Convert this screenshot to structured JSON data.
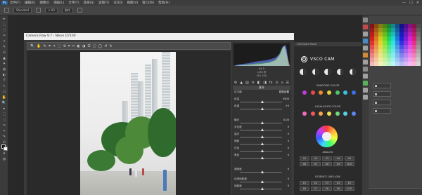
{
  "app": {
    "logo": "Ps",
    "menus": [
      "文件(F)",
      "编辑(E)",
      "图像(I)",
      "图层(L)",
      "文字(Y)",
      "选择(S)",
      "滤镜(T)",
      "3D(D)",
      "视图(V)",
      "窗口(W)",
      "帮助(H)"
    ],
    "window_controls": [
      "—",
      "□",
      "✕"
    ]
  },
  "options_bar": {
    "preset": "Standard",
    "sample": "⊙ 60",
    "mode": "取样"
  },
  "camera_raw": {
    "title": "Camera Raw 9.7 - Nikon D7100",
    "tool_icons": [
      "🔍",
      "✋",
      "✎",
      "✒",
      "⌖",
      "⬚",
      "⟲",
      "⌗",
      "✂",
      "◐",
      "◑",
      "☰",
      "▢",
      "◯",
      "↺",
      "↻"
    ],
    "histogram_info": [
      "f/4.5",
      "1/30 秒",
      "ISO 100",
      "18-55@18 mm"
    ],
    "panel_icons": [
      "⚙",
      "▲",
      "▤",
      "≡",
      "◧",
      "◨",
      "fx",
      "⊙",
      "⌂",
      "☰"
    ],
    "section": "基本",
    "sliders": [
      {
        "label": "白平衡",
        "value": "原照设置"
      },
      {
        "label": "色温",
        "value": "5500"
      },
      {
        "label": "色调",
        "value": "+5"
      },
      {
        "label": "曝光",
        "value": "0.00"
      },
      {
        "label": "对比度",
        "value": "0"
      },
      {
        "label": "高光",
        "value": "0"
      },
      {
        "label": "阴影",
        "value": "0"
      },
      {
        "label": "白色",
        "value": "0"
      },
      {
        "label": "黑色",
        "value": "0"
      },
      {
        "label": "清晰度",
        "value": "0"
      },
      {
        "label": "自然饱和度",
        "value": "0"
      },
      {
        "label": "饱和度",
        "value": "0"
      }
    ]
  },
  "vsco": {
    "panel_title": "VSCOCam Panel",
    "logo_text": "VSCO CAM",
    "shadows_label": "SHADOWS COLOR",
    "highlights_label": "HIGHLIGHTS COLOR",
    "analog_label": "ANALOG",
    "essence_label": "ESSENCE | MELLOW",
    "shadow_dots": [
      "#c23bdc",
      "#e84a4a",
      "#ef8a2e",
      "#e8d33a",
      "#4cc96a",
      "#3bbfe0",
      "#3b6fe8"
    ],
    "highlight_dots": [
      "#f06eb8",
      "#f25a5a",
      "#f5a64a",
      "#efe04d",
      "#6fd87e",
      "#59cfe8",
      "#5a86ef"
    ],
    "analog_buttons": [
      "A1",
      "A2",
      "A3",
      "A4",
      "A5",
      "A6",
      "A7",
      "A8",
      "A9",
      "A10"
    ],
    "essence_buttons": [
      "E1",
      "E2",
      "E3",
      "E4",
      "E5",
      "E6",
      "E7",
      "E8",
      "E9",
      "E10"
    ]
  }
}
